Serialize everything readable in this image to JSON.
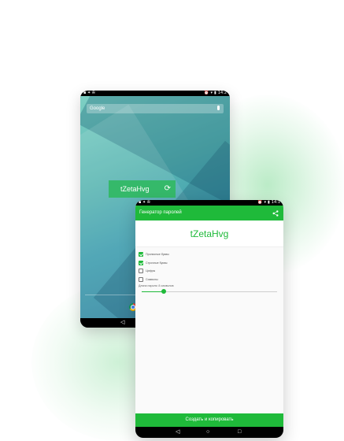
{
  "back_phone": {
    "status_time": "14:2",
    "search_label": "Google",
    "widget_password": "tZetaHvg",
    "nav_back": "◁"
  },
  "front_phone": {
    "status_time": "14:1",
    "app_title": "Генератор паролей",
    "password": "tZetaHvg",
    "options": [
      {
        "label": "Прописные буквы",
        "checked": true
      },
      {
        "label": "Строчные буквы",
        "checked": true
      },
      {
        "label": "Цифры",
        "checked": false
      },
      {
        "label": "Символы",
        "checked": false
      }
    ],
    "length_label": "Длина пароля: 8 символов",
    "length_fraction": 0.16,
    "generate_button": "Создать и копировать",
    "nav": {
      "back": "◁",
      "home": "○",
      "recent": "□"
    }
  },
  "colors": {
    "accent": "#1fba3a",
    "widget": "#35b96a"
  },
  "icons": [
    "share-icon",
    "refresh-icon",
    "mic-icon",
    "chrome-icon",
    "checkbox-icon"
  ]
}
